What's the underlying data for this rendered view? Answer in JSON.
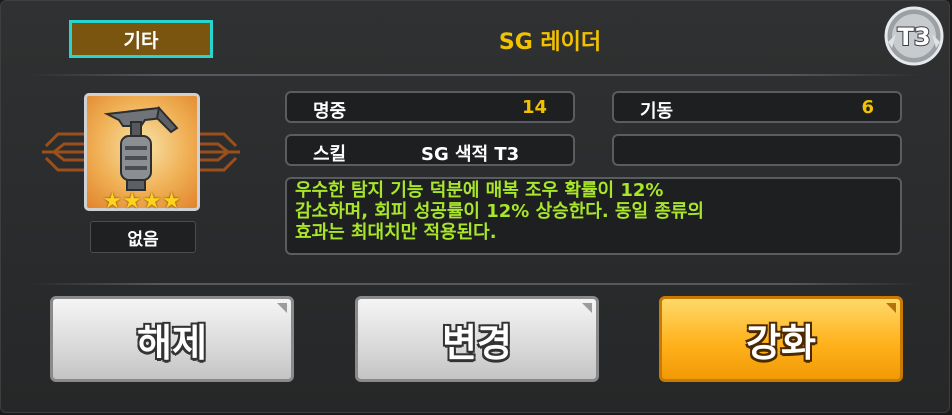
{
  "header": {
    "category_label": "기타",
    "item_name": "SG 레이더",
    "tier_badge": "T3"
  },
  "item": {
    "icon": "radar-device-icon",
    "stars": 4,
    "star_glyph": "★",
    "equipped_by": "없음"
  },
  "stats": {
    "accuracy_label": "명중",
    "accuracy_value": "14",
    "mobility_label": "기동",
    "mobility_value": "6",
    "skill_label": "스킬",
    "skill_value": "SG 색적 T3"
  },
  "description": "우수한 탐지 기능 덕분에 매복 조우 확률이 12%\n감소하며, 회피 성공률이 12% 상승한다. 동일 종류의\n효과는 최대치만 적용된다.",
  "buttons": {
    "unequip": "해제",
    "change": "변경",
    "enhance": "강화"
  },
  "colors": {
    "title": "#f2c200",
    "description": "#a8e62a",
    "category_bg": "#7a5510",
    "category_border": "#2ad4ce",
    "enhance_button": "#ffb21d"
  }
}
